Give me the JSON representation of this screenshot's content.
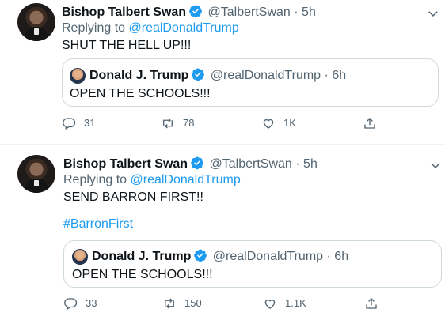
{
  "tweets": [
    {
      "author_name": "Bishop Talbert Swan",
      "handle": "@TalbertSwan",
      "time": "5h",
      "replying_prefix": "Replying to",
      "replying_to": "@realDonaldTrump",
      "text": "SHUT THE HELL UP!!!",
      "hashtag": "",
      "quote": {
        "author_name": "Donald J. Trump",
        "handle": "@realDonaldTrump",
        "time": "6h",
        "text": "OPEN THE SCHOOLS!!!"
      },
      "replies": "31",
      "retweets": "78",
      "likes": "1K"
    },
    {
      "author_name": "Bishop Talbert Swan",
      "handle": "@TalbertSwan",
      "time": "5h",
      "replying_prefix": "Replying to",
      "replying_to": "@realDonaldTrump",
      "text": "SEND BARRON FIRST!!",
      "hashtag": "#BarronFirst",
      "quote": {
        "author_name": "Donald J. Trump",
        "handle": "@realDonaldTrump",
        "time": "6h",
        "text": "OPEN THE SCHOOLS!!!"
      },
      "replies": "33",
      "retweets": "150",
      "likes": "1.1K"
    }
  ],
  "separator": "·",
  "colors": {
    "link": "#1d9bf0",
    "muted": "#536471",
    "border": "#cfd9de",
    "verified": "#1d9bf0"
  },
  "icons": [
    "verified-badge-icon",
    "chevron-down-icon",
    "reply-icon",
    "retweet-icon",
    "like-icon",
    "share-icon"
  ]
}
